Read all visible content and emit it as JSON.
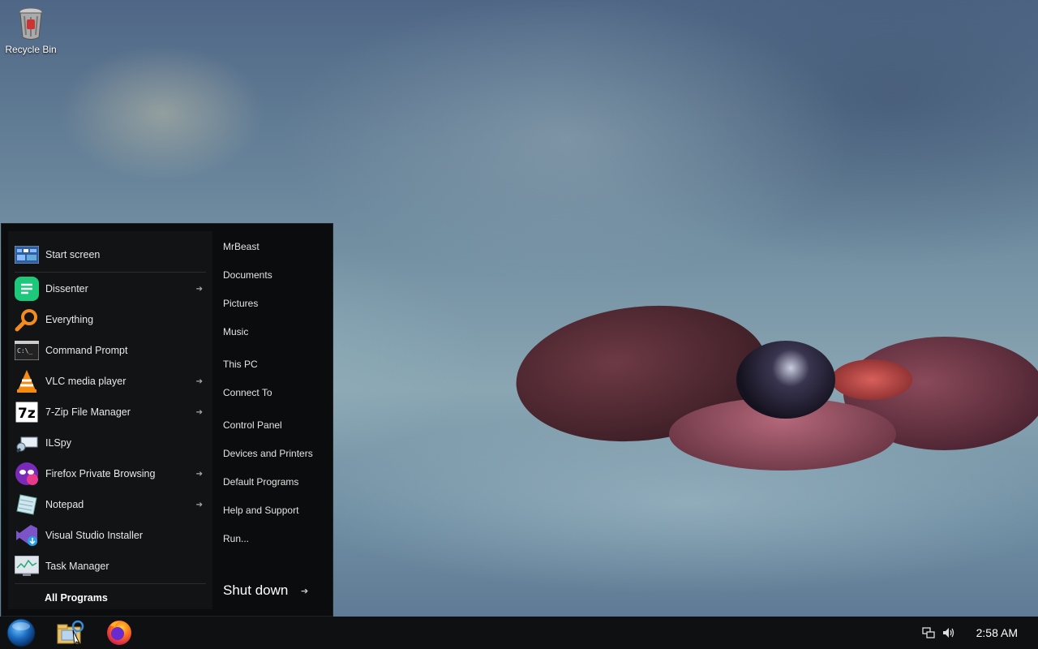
{
  "desktop": {
    "recycle_bin_label": "Recycle Bin"
  },
  "start_menu": {
    "pinned": [
      {
        "label": "Start screen",
        "icon": "start-screen-icon",
        "has_submenu": false
      },
      {
        "label": "Dissenter",
        "icon": "dissenter-icon",
        "has_submenu": true
      },
      {
        "label": "Everything",
        "icon": "search-icon",
        "has_submenu": false
      },
      {
        "label": "Command Prompt",
        "icon": "command-prompt-icon",
        "has_submenu": false
      },
      {
        "label": "VLC media player",
        "icon": "vlc-icon",
        "has_submenu": true
      },
      {
        "label": "7-Zip File Manager",
        "icon": "7zip-icon",
        "has_submenu": true
      },
      {
        "label": "ILSpy",
        "icon": "ilspy-icon",
        "has_submenu": false
      },
      {
        "label": "Firefox Private Browsing",
        "icon": "firefox-private-icon",
        "has_submenu": true
      },
      {
        "label": "Notepad",
        "icon": "notepad-icon",
        "has_submenu": true
      },
      {
        "label": "Visual Studio Installer",
        "icon": "visual-studio-icon",
        "has_submenu": false
      },
      {
        "label": "Task Manager",
        "icon": "task-manager-icon",
        "has_submenu": false
      }
    ],
    "all_programs": "All Programs",
    "right_links": [
      "MrBeast",
      "Documents",
      "Pictures",
      "Music",
      "This PC",
      "Connect To",
      "Control Panel",
      "Devices and Printers",
      "Default Programs",
      "Help and Support",
      "Run..."
    ],
    "shutdown_label": "Shut down",
    "shutdown_arrow": "➔"
  },
  "taskbar": {
    "clock": "2:58 AM",
    "arrow_glyph": "➔"
  },
  "colors": {
    "menu_bg": "#0b0c0d",
    "taskbar_bg": "#0e1012"
  }
}
